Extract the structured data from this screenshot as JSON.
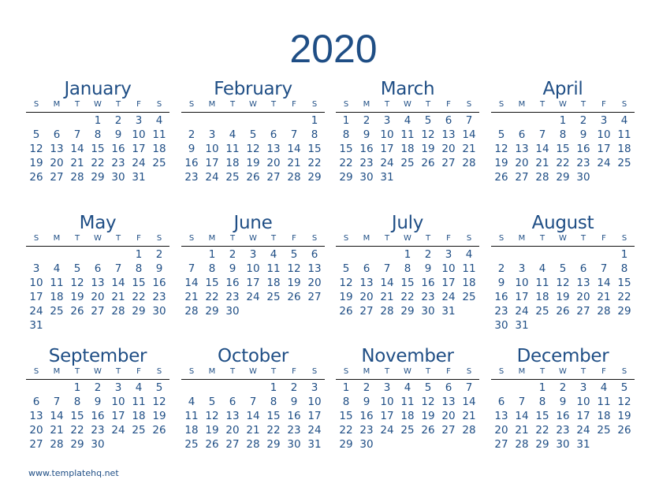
{
  "year": "2020",
  "weekdays": [
    "S",
    "M",
    "T",
    "W",
    "T",
    "F",
    "S"
  ],
  "footer": "www.templatehq.net",
  "accent_color": "#1f4e85",
  "months": [
    {
      "name": "January",
      "offset": 3,
      "days": 31
    },
    {
      "name": "February",
      "offset": 6,
      "days": 29
    },
    {
      "name": "March",
      "offset": 0,
      "days": 31
    },
    {
      "name": "April",
      "offset": 3,
      "days": 30
    },
    {
      "name": "May",
      "offset": 5,
      "days": 31
    },
    {
      "name": "June",
      "offset": 1,
      "days": 30
    },
    {
      "name": "July",
      "offset": 3,
      "days": 31
    },
    {
      "name": "August",
      "offset": 6,
      "days": 31
    },
    {
      "name": "September",
      "offset": 2,
      "days": 30
    },
    {
      "name": "October",
      "offset": 4,
      "days": 31
    },
    {
      "name": "November",
      "offset": 0,
      "days": 30
    },
    {
      "name": "December",
      "offset": 2,
      "days": 31
    }
  ]
}
